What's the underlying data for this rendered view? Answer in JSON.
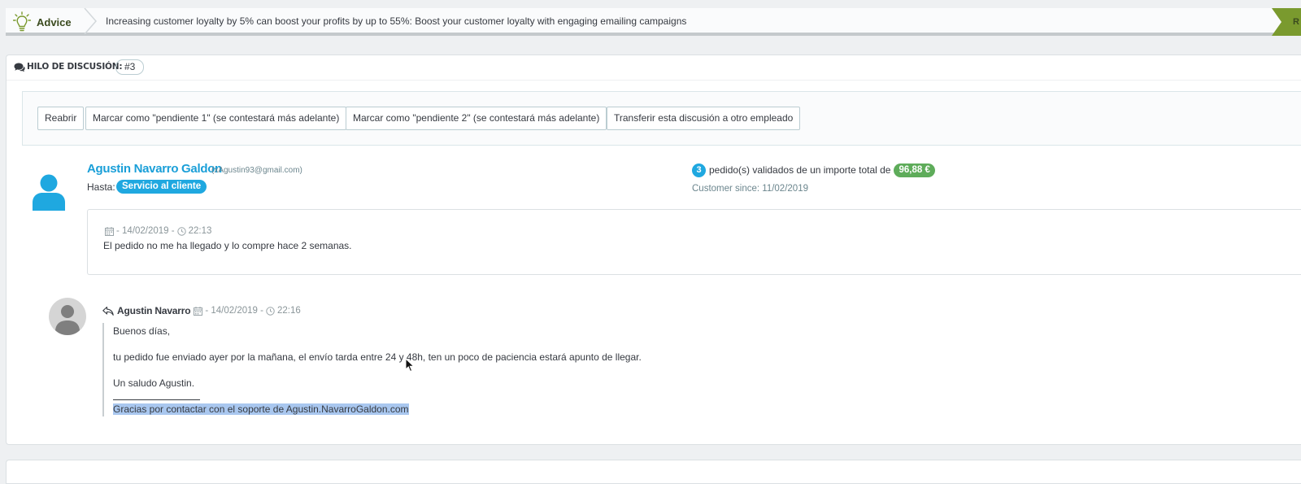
{
  "advice": {
    "title": "Advice",
    "text": "Increasing customer loyalty by 5% can boost your profits by up to 55%: Boost your customer loyalty with engaging emailing campaigns",
    "flag_label": "R"
  },
  "thread": {
    "label": "HILO DE DISCUSIÓN:",
    "id": "#3"
  },
  "actions": {
    "reopen": "Reabrir",
    "pending1": "Marcar como \"pendiente 1\" (se contestará más adelante)",
    "pending2": "Marcar como \"pendiente 2\" (se contestará más adelante)",
    "transfer": "Transferir esta discusión a otro empleado"
  },
  "customer": {
    "name": "Agustin Navarro Galdon",
    "email": "(xAgustin93@gmail.com)",
    "to_label": "Hasta:",
    "to_value": "Servicio al cliente",
    "orders_count": "3",
    "orders_text": "pedido(s) validados de un importe total de",
    "orders_total": "96,88 €",
    "since": "Customer since: 11/02/2019"
  },
  "message": {
    "date": "- 14/02/2019 -",
    "time": "22:13",
    "body": "El pedido no me ha llegado y lo compre hace 2 semanas."
  },
  "reply": {
    "author": "Agustin Navarro",
    "date": "- 14/02/2019 -",
    "time": "22:16",
    "line1": "Buenos días,",
    "line2": "tu pedido fue enviado ayer por la mañana, el envío tarda entre 24 y 48h, ten un poco de paciencia estará apunto de llegar.",
    "line3": "Un saludo Agustin.",
    "signature": "Gracias por contactar con el soporte de Agustin.NavarroGaldon.com"
  },
  "colors": {
    "accent_blue": "#1fa8e0",
    "success_green": "#5eac5a",
    "advice_green": "#7a9a2e",
    "selection": "#a9c7ef"
  }
}
